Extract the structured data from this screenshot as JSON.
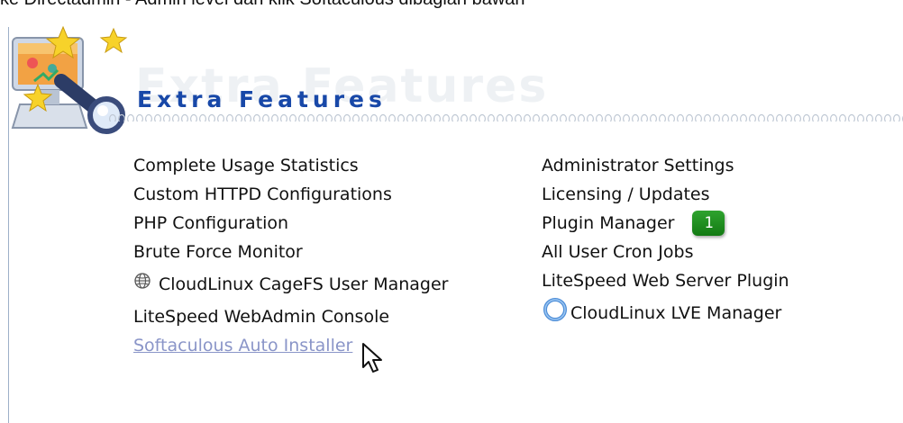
{
  "caption": "ke Directadmin - Admin level dan klik Softaculous dibagian bawah",
  "section": {
    "title": "Extra Features",
    "watermark": "Extra Features"
  },
  "left_column": [
    {
      "label": "Complete Usage Statistics"
    },
    {
      "label": "Custom HTTPD Configurations"
    },
    {
      "label": "PHP Configuration"
    },
    {
      "label": "Brute Force Monitor"
    },
    {
      "label": "CloudLinux CageFS User Manager",
      "icon": "globe-icon"
    },
    {
      "label": "LiteSpeed WebAdmin Console"
    },
    {
      "label": "Softaculous Auto Installer",
      "state": "hovered"
    }
  ],
  "right_column": [
    {
      "label": "Administrator Settings"
    },
    {
      "label": "Licensing / Updates"
    },
    {
      "label": "Plugin Manager",
      "badge": "1"
    },
    {
      "label": "All User Cron Jobs"
    },
    {
      "label": "LiteSpeed Web Server Plugin"
    },
    {
      "label": "CloudLinux LVE Manager",
      "icon": "ring-icon"
    }
  ],
  "colors": {
    "title": "#1848a8",
    "badge": "#1f8f1f",
    "hover_link": "#8a95c8"
  }
}
